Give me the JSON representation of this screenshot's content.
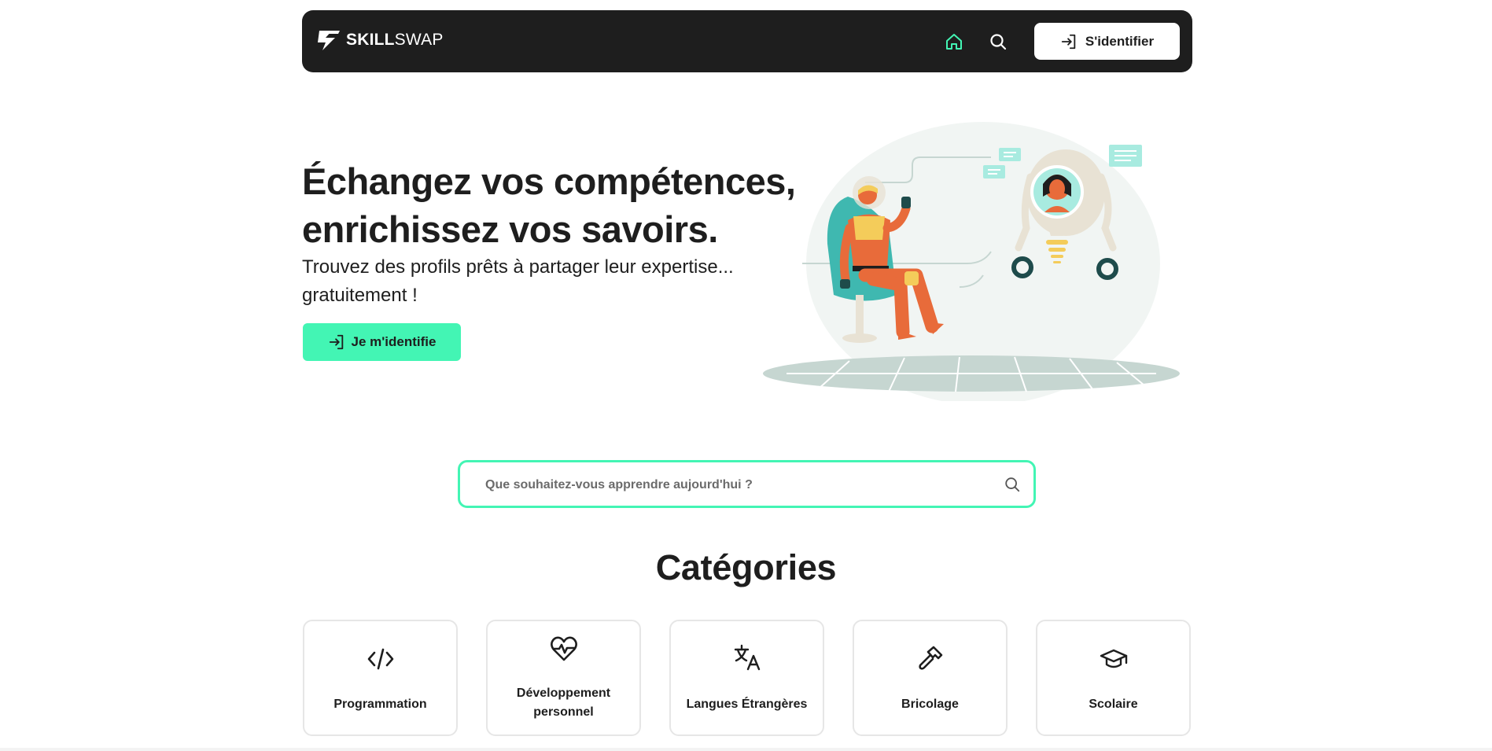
{
  "navbar": {
    "logo": {
      "bold": "SKILL",
      "light": "SWAP",
      "icon": "skillswap-logo-icon"
    },
    "home_icon": "home-icon",
    "search_icon": "search-icon",
    "login_label": "S'identifier",
    "login_icon": "login-arrow-icon"
  },
  "hero": {
    "title_line1": "Échangez vos compétences,",
    "title_line2": "enrichissez vos savoirs.",
    "subtitle_line1": "Trouvez des profils prêts à partager leur expertise...",
    "subtitle_line2": "gratuitement !",
    "cta_label": "Je m'identifie",
    "cta_icon": "login-arrow-icon"
  },
  "search": {
    "placeholder": "Que souhaitez-vous apprendre aujourd'hui ?",
    "icon": "search-icon"
  },
  "categories": {
    "title": "Catégories",
    "items": [
      {
        "label_line1": "Programmation",
        "label_line2": "",
        "icon": "code-icon"
      },
      {
        "label_line1": "Développement",
        "label_line2": "personnel",
        "icon": "heart-pulse-icon"
      },
      {
        "label_line1": "Langues Étrangères",
        "label_line2": "",
        "icon": "translate-icon"
      },
      {
        "label_line1": "Bricolage",
        "label_line2": "",
        "icon": "hammer-icon"
      },
      {
        "label_line1": "Scolaire",
        "label_line2": "",
        "icon": "graduation-cap-icon"
      }
    ]
  },
  "colors": {
    "accent": "#43f5b4",
    "navbar_bg": "#1e1e1e",
    "text": "#1e1e1e"
  }
}
